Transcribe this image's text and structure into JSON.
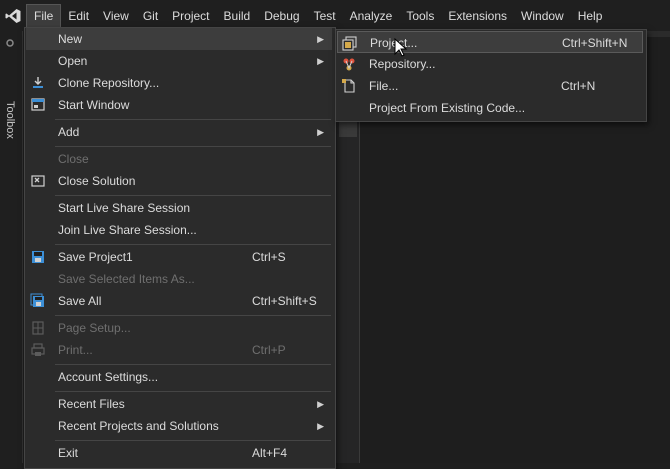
{
  "menubar": {
    "items": [
      "File",
      "Edit",
      "View",
      "Git",
      "Project",
      "Build",
      "Debug",
      "Test",
      "Analyze",
      "Tools",
      "Extensions",
      "Window",
      "Help"
    ]
  },
  "toolbox": {
    "label": "Toolbox"
  },
  "file_menu": {
    "new": {
      "label": "New"
    },
    "open": {
      "label": "Open"
    },
    "clone": {
      "label": "Clone Repository..."
    },
    "start_window": {
      "label": "Start Window"
    },
    "add": {
      "label": "Add"
    },
    "close": {
      "label": "Close"
    },
    "close_solution": {
      "label": "Close Solution"
    },
    "start_live_share": {
      "label": "Start Live Share Session"
    },
    "join_live_share": {
      "label": "Join Live Share Session..."
    },
    "save_project": {
      "label": "Save Project1",
      "shortcut": "Ctrl+S"
    },
    "save_selected": {
      "label": "Save Selected Items As..."
    },
    "save_all": {
      "label": "Save All",
      "shortcut": "Ctrl+Shift+S"
    },
    "page_setup": {
      "label": "Page Setup..."
    },
    "print": {
      "label": "Print...",
      "shortcut": "Ctrl+P"
    },
    "account_settings": {
      "label": "Account Settings..."
    },
    "recent_files": {
      "label": "Recent Files"
    },
    "recent_projects": {
      "label": "Recent Projects and Solutions"
    },
    "exit": {
      "label": "Exit",
      "shortcut": "Alt+F4"
    }
  },
  "new_submenu": {
    "project": {
      "label": "Project...",
      "shortcut": "Ctrl+Shift+N"
    },
    "repository": {
      "label": "Repository..."
    },
    "file": {
      "label": "File...",
      "shortcut": "Ctrl+N"
    },
    "from_existing": {
      "label": "Project From Existing Code..."
    }
  },
  "colors": {
    "background": "#1f1f1f",
    "menu_bg": "#2b2b2b",
    "hover": "#3d3d3d",
    "text": "#dcdcdc",
    "disabled_text": "#6f6f6f",
    "accent_blue": "#3c8fd6",
    "vs_purple": "#c8a6ff"
  }
}
